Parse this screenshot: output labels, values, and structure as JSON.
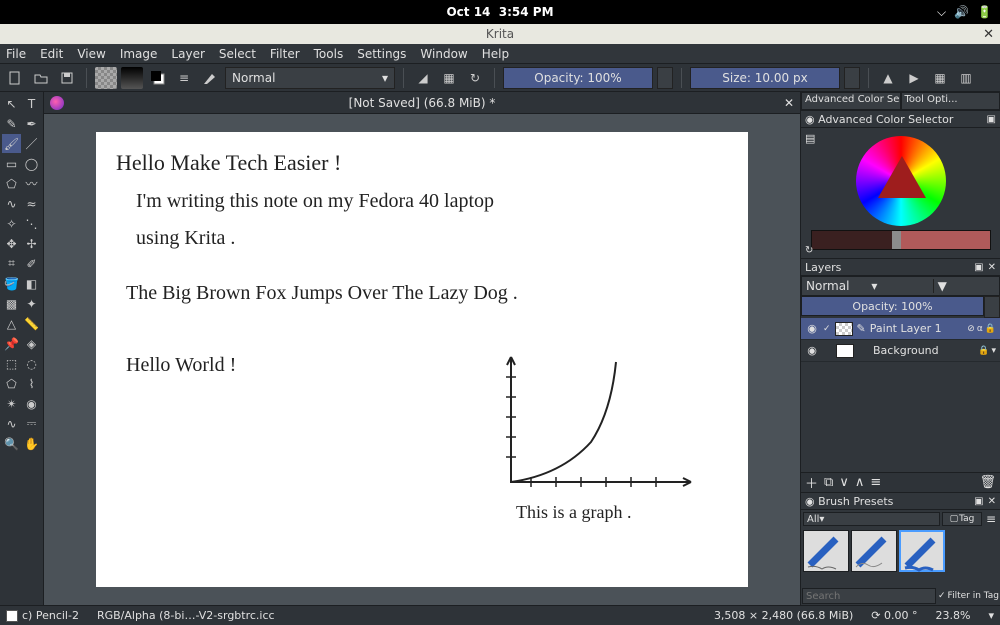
{
  "system": {
    "date": "Oct 14",
    "time": "3:54 PM"
  },
  "app_title": "Krita",
  "menu": [
    "File",
    "Edit",
    "View",
    "Image",
    "Layer",
    "Select",
    "Filter",
    "Tools",
    "Settings",
    "Window",
    "Help"
  ],
  "toolbar": {
    "blend_mode": "Normal",
    "opacity_label": "Opacity: 100%",
    "size_label": "Size: 10.00 px"
  },
  "document": {
    "title": "[Not Saved]  (66.8 MiB) *",
    "canvas_text": {
      "l1": "Hello Make Tech Easier !",
      "l2": "I'm writing this note on my Fedora 40 laptop",
      "l3": "using Krita .",
      "l4": "The Big Brown Fox Jumps Over The Lazy Dog .",
      "l5": "Hello World !",
      "l6": "This is a graph ."
    }
  },
  "right": {
    "tab1": "Advanced Color Selec...",
    "tab2": "Tool Opti...",
    "acs_title": "Advanced Color Selector",
    "layers_title": "Layers",
    "layer_blend": "Normal",
    "layer_opacity": "Opacity:  100%",
    "layers": [
      {
        "name": "Paint Layer 1",
        "active": true
      },
      {
        "name": "Background",
        "active": false
      }
    ],
    "presets_title": "Brush Presets",
    "preset_filter": "All",
    "preset_tag": "Tag",
    "search_placeholder": "Search",
    "filter_in_tag": "Filter in Tag"
  },
  "status": {
    "brush": "c) Pencil-2",
    "colormode": "RGB/Alpha (8-bi…-V2-srgbtrc.icc",
    "dims": "3,508 × 2,480 (66.8 MiB)",
    "rotation": "0.00 °",
    "zoom": "23.8%"
  }
}
